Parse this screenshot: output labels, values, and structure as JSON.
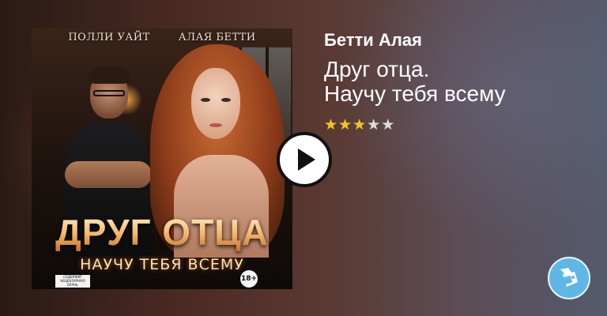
{
  "cover": {
    "authors": [
      "ПОЛЛИ УАЙТ",
      "АЛАЯ БЕТТИ"
    ],
    "title": "ДРУГ ОТЦА",
    "subtitle": "НАУЧУ ТЕБЯ ВСЕМУ",
    "label": "СОДЕРЖИТ НЕЦЕНЗУРНУЮ БРАНЬ",
    "age_rating": "18+"
  },
  "book": {
    "author": "Бетти Алая",
    "title_line1": "Друг отца.",
    "title_line2": "Научу тебя всему",
    "rating": 3,
    "rating_max": 5
  },
  "icons": {
    "play": "play-icon",
    "mascot": "mascot-icon",
    "star_full": "★",
    "star_empty": "★"
  },
  "colors": {
    "star_full": "#f3c22b",
    "star_empty": "#dcdcdc",
    "mascot_bg": "#5fb7e6"
  }
}
